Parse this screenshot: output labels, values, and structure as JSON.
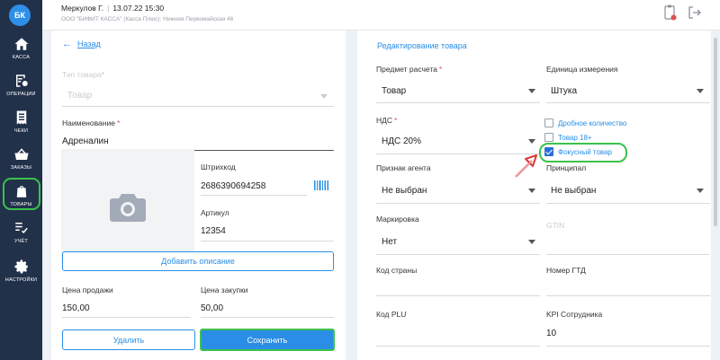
{
  "brand": {
    "initials": "БК"
  },
  "sidebar": {
    "items": [
      {
        "label": "КАССА",
        "icon": "home-icon"
      },
      {
        "label": "ОПЕРАЦИИ",
        "icon": "operations-icon"
      },
      {
        "label": "ЧЕКИ",
        "icon": "receipt-icon"
      },
      {
        "label": "ЗАКАЗЫ",
        "icon": "basket-icon"
      },
      {
        "label": "ТОВАРЫ",
        "icon": "bag-icon"
      },
      {
        "label": "УЧЁТ",
        "icon": "checklist-icon"
      },
      {
        "label": "НАСТРОЙКИ",
        "icon": "gear-icon"
      }
    ],
    "active": "ТОВАРЫ"
  },
  "header": {
    "user": "Меркулов Г.",
    "datetime": "13.07.22 15:30",
    "org": "ООО \"БИФИТ КАССА\" (Касса Плюс): Нижняя Первомайская 46",
    "icons": [
      "clipboard-icon",
      "logout-icon"
    ]
  },
  "left": {
    "back_label": "Назад",
    "type_label": "Тип товара",
    "type_value": "Товар",
    "name_label": "Наименование",
    "name_value": "Адреналин",
    "barcode_label": "Штрихкод",
    "barcode_value": "2686390694258",
    "article_label": "Артикул",
    "article_value": "12354",
    "add_description": "Добавить описание",
    "sale_price_label": "Цена продажи",
    "sale_price_value": "150,00",
    "purchase_price_label": "Цена закупки",
    "purchase_price_value": "50,00",
    "delete_label": "Удалить",
    "save_label": "Сохранить"
  },
  "right": {
    "title": "Редактирование товара",
    "subject_label": "Предмет расчета",
    "subject_value": "Товар",
    "unit_label": "Единица измерения",
    "unit_value": "Штука",
    "vat_label": "НДС",
    "vat_value": "НДС 20%",
    "checkboxes": [
      {
        "label": "Дробное количество",
        "checked": false
      },
      {
        "label": "Товар 18+",
        "checked": false
      },
      {
        "label": "Фокусный товар",
        "checked": true
      }
    ],
    "agent_label": "Признак агента",
    "agent_value": "Не выбран",
    "principal_label": "Принципал",
    "principal_value": "Не выбран",
    "marking_label": "Маркировка",
    "marking_value": "Нет",
    "gtin_label": "GTIN",
    "country_label": "Код страны",
    "gtd_label": "Номер ГТД",
    "plu_label": "Код PLU",
    "kpi_label": "KPI Сотрудника",
    "kpi_value": "10"
  },
  "colors": {
    "accent": "#2a8ee6",
    "sidebar": "#22314a",
    "highlight": "#3cc24c",
    "arrow": "#d93a3a"
  }
}
